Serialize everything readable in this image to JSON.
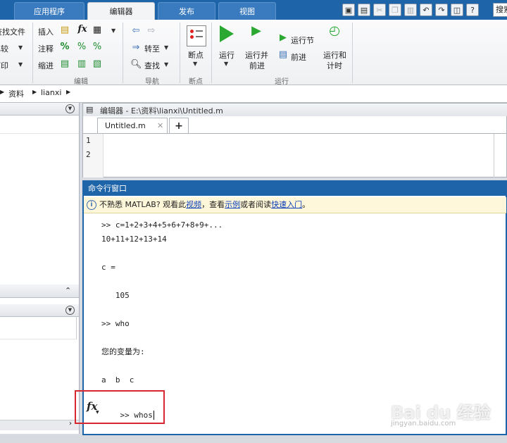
{
  "tabs": [
    "应用程序",
    "编辑器",
    "发布",
    "视图"
  ],
  "active_tab": "编辑器",
  "quick_access_icons": [
    "new-icon",
    "save-icon",
    "cut-icon",
    "copy-icon",
    "paste-icon",
    "undo-icon",
    "redo-icon",
    "window-icon",
    "help-icon"
  ],
  "search_text": "搜索",
  "ribbon": {
    "file_group": {
      "find_files": "查找文件",
      "compare": "比较",
      "print": "打印"
    },
    "edit_group": {
      "insert": "插入",
      "comment": "注释",
      "indent": "缩进",
      "fx": "fx",
      "label": "编辑"
    },
    "nav_group": {
      "goto": "转至",
      "find": "查找",
      "label": "导航"
    },
    "bp_group": {
      "breakpoints": "断点",
      "label": "断点"
    },
    "run_group": {
      "run": "运行",
      "run_advance_1": "运行并",
      "run_advance_2": "前进",
      "run_section": "运行节",
      "advance": "前进",
      "run_time_1": "运行和",
      "run_time_2": "计时",
      "label": "运行"
    }
  },
  "breadcrumb": [
    "资料",
    "lianxi"
  ],
  "editor": {
    "title": "编辑器 - E:\\资料\\lianxi\\Untitled.m",
    "file_tab": "Untitled.m",
    "add_tab": "+",
    "line_numbers": [
      "1",
      "2"
    ]
  },
  "command_window": {
    "title": "命令行窗口",
    "info_prefix": "不熟悉 MATLAB? 观看此",
    "info_link_video": "视频",
    "info_mid1": "，查看",
    "info_link_examples": "示例",
    "info_mid2": "或者阅读",
    "info_link_start": "快速入门",
    "info_suffix": "。",
    "lines": [
      ">> c=1+2+3+4+5+6+7+8+9+...",
      "10+11+12+13+14",
      "",
      "c =",
      "",
      "   105",
      "",
      ">> who",
      "",
      "您的变量为:",
      "",
      "a  b  c",
      ""
    ],
    "prompt_line": ">> whos",
    "fx_label": "fx"
  },
  "watermark": {
    "text": "Bai du 经验",
    "url": "jingyan.baidu.com"
  },
  "colors": {
    "accent": "#1e64a9",
    "highlight_box": "#d7282f",
    "info_bar": "#fff7d9"
  }
}
